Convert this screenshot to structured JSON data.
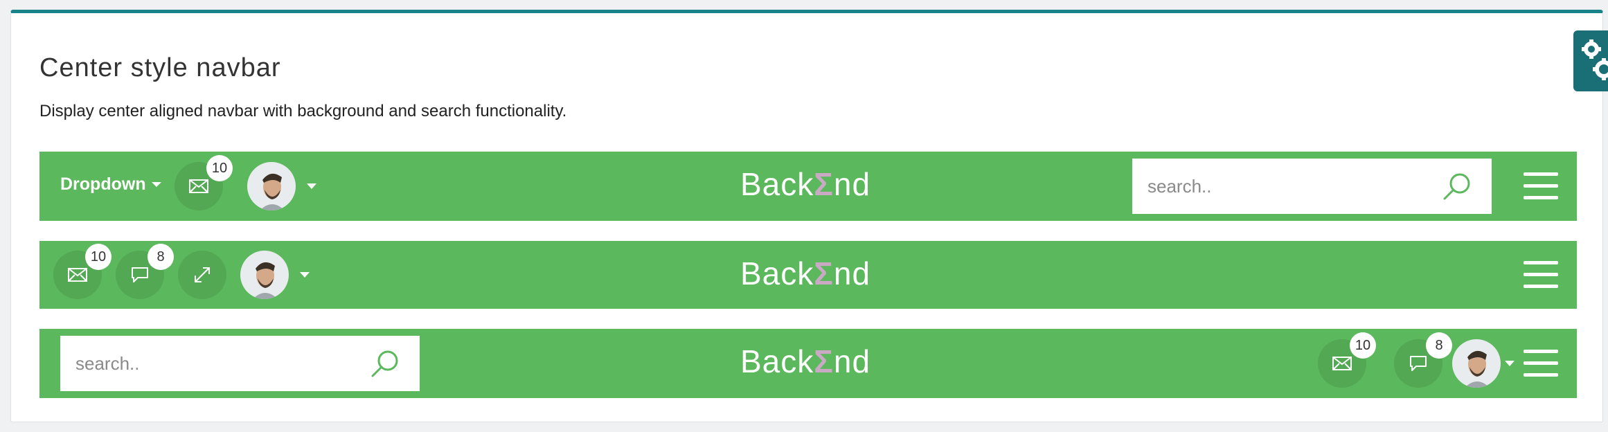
{
  "card": {
    "title": "Center style navbar",
    "description": "Display center aligned navbar with background and search functionality."
  },
  "navbar1": {
    "dropdown_label": "Dropdown",
    "mail_badge": "10",
    "brand": {
      "left": "Back",
      "sigma": "Σ",
      "right": "nd"
    },
    "search_placeholder": "search.."
  },
  "navbar2": {
    "mail_badge": "10",
    "chat_badge": "8",
    "brand": {
      "left": "Back",
      "sigma": "Σ",
      "right": "nd"
    }
  },
  "navbar3": {
    "search_placeholder": "search..",
    "brand": {
      "left": "Back",
      "sigma": "Σ",
      "right": "nd"
    },
    "mail_badge": "10",
    "chat_badge": "8"
  },
  "colors": {
    "navbar_bg": "#5cb85c",
    "accent": "#1a8289",
    "icon_circle": "#53a853",
    "search_icon": "#5cb85c"
  },
  "icons": [
    "mail-icon",
    "chat-icon",
    "expand-icon",
    "search-icon",
    "hamburger-icon",
    "gear-icon",
    "caret-down-icon"
  ]
}
